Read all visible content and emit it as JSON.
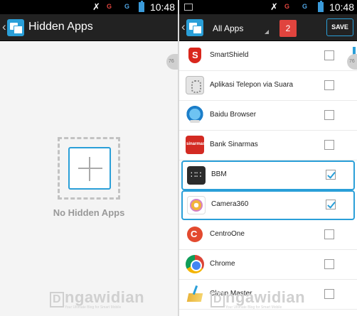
{
  "left": {
    "status": {
      "time": "10:48",
      "sim1": "G",
      "sim2": "G"
    },
    "header": {
      "title": "Hidden Apps"
    },
    "empty_state": {
      "text": "No Hidden Apps"
    },
    "edge_tab": "76",
    "watermark": {
      "letter": "D",
      "text": "ngawidian",
      "tagline": "Your Ultimate Blog for Smart Mobile"
    }
  },
  "right": {
    "status": {
      "time": "10:48",
      "sim1": "G",
      "sim2": "G"
    },
    "header": {
      "filter_label": "All Apps",
      "selected_count": "2",
      "save_label": "SAVE"
    },
    "apps": [
      {
        "name": "SmartShield",
        "icon": "smartshield-icon",
        "checked": false
      },
      {
        "name": "Aplikasi Telepon via Suara",
        "icon": "voice-dialer-icon",
        "checked": false
      },
      {
        "name": "Baidu Browser",
        "icon": "baidu-browser-icon",
        "checked": false
      },
      {
        "name": "Bank Sinarmas",
        "icon": "bank-sinarmas-icon",
        "checked": false
      },
      {
        "name": "BBM",
        "icon": "bbm-icon",
        "checked": true
      },
      {
        "name": "Camera360",
        "icon": "camera360-icon",
        "checked": true
      },
      {
        "name": "CentroOne",
        "icon": "centroone-icon",
        "checked": false
      },
      {
        "name": "Chrome",
        "icon": "chrome-icon",
        "checked": false
      },
      {
        "name": "Clean Master",
        "icon": "clean-master-icon",
        "checked": false
      }
    ],
    "edge_tab": "76",
    "watermark": {
      "letter": "D",
      "text": "ngawidian",
      "tagline": "Your Ultimate Blog for Smart Mobile"
    }
  },
  "colors": {
    "accent": "#2a9fd8",
    "badge": "#e0443e",
    "actionbar": "#222222"
  }
}
